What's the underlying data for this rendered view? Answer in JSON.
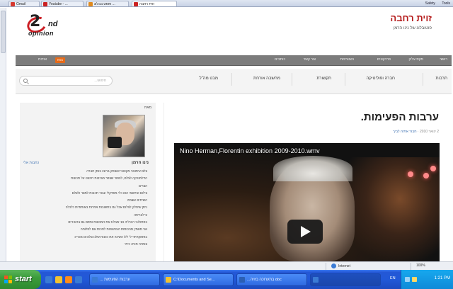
{
  "browser": {
    "tabs": [
      {
        "label": "Gmail",
        "favicon_color": "#d6382e"
      },
      {
        "label": "Youtube - ...",
        "favicon_color": "#cc2222"
      },
      {
        "label": "פוסט בבלוג ...",
        "favicon_color": "#e08a1e"
      },
      {
        "label": "זוית רחבה",
        "favicon_color": "#cc2222"
      }
    ],
    "right_items": [
      "Safety",
      "Tools"
    ]
  },
  "site": {
    "logo_number": "2",
    "logo_suffix": "nd",
    "logo_word": "opinion",
    "title": "זוית רחבה",
    "subtitle": "פוטובלוג של נינו הרמן"
  },
  "top_nav": {
    "items": [
      "ראשי",
      "מקס עליון",
      "פרויקטים",
      "הצטרפות",
      "צור קשר",
      "כותבים",
      "אודות"
    ],
    "rss_label": "RSS",
    "accent": "#e66b1a"
  },
  "categories": {
    "items": [
      "תרבות",
      "חברה ופוליטיקה",
      "תקשורת",
      "מחשבה אורחת",
      "מבט מה\"ל"
    ],
    "search_placeholder": "חיפוש..."
  },
  "sidebar": {
    "heading": "מאת",
    "author_name": "נינו הרמן",
    "read_more": "כתבות אלי",
    "bio_lines": [
      "צלם עיתונאי מקצועי שעוסק ברובו בזמן חברה",
      "הדלמטיקה לצלם, לצפור שצפר מגרבות חיטוט על תכונות",
      "הצרים",
      "צילום עיתונאי הוא כלי מוסיקלי עבור תכבות למצר ולצלם",
      "השיחים עוצמה",
      "ניתן שיחלק לצלום אבל גם בתשובות אחרות באותודות כלכלה",
      "ע־לעריפה",
      "בפתולוגי היגיליה אני מבליג את המכונות וחסם גם בהעיניים",
      "אני מאמין מהכוסות העכשוויות לחכות אם לפלוחה",
      "בפסוקתיפי לי ללו השינה את כוונות שלנו צלוכים מכריכ",
      "צומרה חוויה כיתי"
    ]
  },
  "post": {
    "title": "ערבות הפעימות.",
    "date": "2 ינואר 2010",
    "author_link": "חבור אתיה לביך",
    "video_title": "Nino Herman,Florentin exhibition 2009-2010.wmv"
  },
  "status_bar": {
    "zone": "Internet",
    "zoom": "100%"
  },
  "taskbar": {
    "start_label": "start",
    "tasks": [
      {
        "label": "... ערבות הפעימות",
        "icon_color": "#3a7bd5",
        "active": false
      },
      {
        "label": "C:\\Documents and Se...",
        "icon_color": "#f1c232",
        "active": false
      },
      {
        "label": "...בתערוכה בזויה doc",
        "icon_color": "#2b5fb4",
        "active": false
      },
      {
        "label": "",
        "icon_color": "#3a7bd5",
        "active": true
      }
    ],
    "language": "EN",
    "clock": "1:21 PM"
  }
}
